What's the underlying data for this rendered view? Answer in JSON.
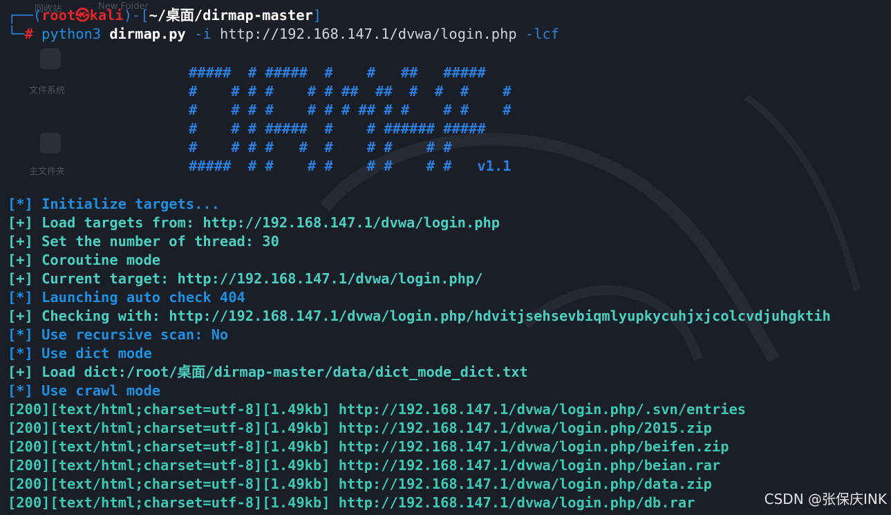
{
  "desktop": {
    "ghost_labels": [
      "回收站",
      "New Folder",
      "文件系统",
      "主文件夹"
    ]
  },
  "prompt": {
    "box_tl": "┌──(",
    "user": "root",
    "skull": "㉿",
    "host": "kali",
    "mid": ")-[",
    "path": "~/桌面/dirmap-master",
    "end": "]",
    "box_bl": "└─",
    "hash": "#",
    "cmd": "python3",
    "script": "dirmap.py",
    "flag_i": "-i",
    "url": "http://192.168.147.1/dvwa/login.php",
    "flag_lcf": "-lcf"
  },
  "banner": {
    "lines": [
      "#####  # #####  #    #   ##   #####",
      "#    # # #    # # ##  ##  #  #  #    #",
      "#    # # #    # # # ## # #    # #    #",
      "#    # # #####  #    # ###### #####",
      "#    # # #   #  #    # #    # #",
      "#####  # #    # #    # #    # #"
    ],
    "version": "v1.1"
  },
  "log": [
    {
      "tag": "[*]",
      "text": "Initialize targets...",
      "kind": "info"
    },
    {
      "tag": "[+]",
      "text": "Load targets from: http://192.168.147.1/dvwa/login.php",
      "kind": "ok"
    },
    {
      "tag": "[+]",
      "text": "Set the number of thread: 30",
      "kind": "ok"
    },
    {
      "tag": "[+]",
      "text": "Coroutine mode",
      "kind": "ok"
    },
    {
      "tag": "[+]",
      "text": "Current target: http://192.168.147.1/dvwa/login.php/",
      "kind": "ok"
    },
    {
      "tag": "[*]",
      "text": "Launching auto check 404",
      "kind": "info"
    },
    {
      "tag": "[+]",
      "text": "Checking with: http://192.168.147.1/dvwa/login.php/hdvitjsehsevbiqmlyupkycuhjxjcolcvdjuhgktih",
      "kind": "ok"
    },
    {
      "tag": "[*]",
      "text": "Use recursive scan: No",
      "kind": "info"
    },
    {
      "tag": "[*]",
      "text": "Use dict mode",
      "kind": "info"
    },
    {
      "tag": "[+]",
      "text": "Load dict:/root/桌面/dirmap-master/data/dict_mode_dict.txt",
      "kind": "ok"
    },
    {
      "tag": "[*]",
      "text": "Use crawl mode",
      "kind": "info"
    }
  ],
  "results": [
    {
      "prefix": "[200][text/html;charset=utf-8][1.49kb]",
      "url": "http://192.168.147.1/dvwa/login.php/.svn/entries"
    },
    {
      "prefix": "[200][text/html;charset=utf-8][1.49kb]",
      "url": "http://192.168.147.1/dvwa/login.php/2015.zip"
    },
    {
      "prefix": "[200][text/html;charset=utf-8][1.49kb]",
      "url": "http://192.168.147.1/dvwa/login.php/beifen.zip"
    },
    {
      "prefix": "[200][text/html;charset=utf-8][1.49kb]",
      "url": "http://192.168.147.1/dvwa/login.php/beian.rar"
    },
    {
      "prefix": "[200][text/html;charset=utf-8][1.49kb]",
      "url": "http://192.168.147.1/dvwa/login.php/data.zip"
    },
    {
      "prefix": "[200][text/html;charset=utf-8][1.49kb]",
      "url": "http://192.168.147.1/dvwa/login.php/db.rar"
    }
  ],
  "watermark": "CSDN @张保庆INK",
  "colors": {
    "background": "#1a1e26",
    "info": "#1f8fe0",
    "ok": "#4bd0c0",
    "prompt_red": "#e0262b",
    "banner": "#2a7fe0"
  }
}
